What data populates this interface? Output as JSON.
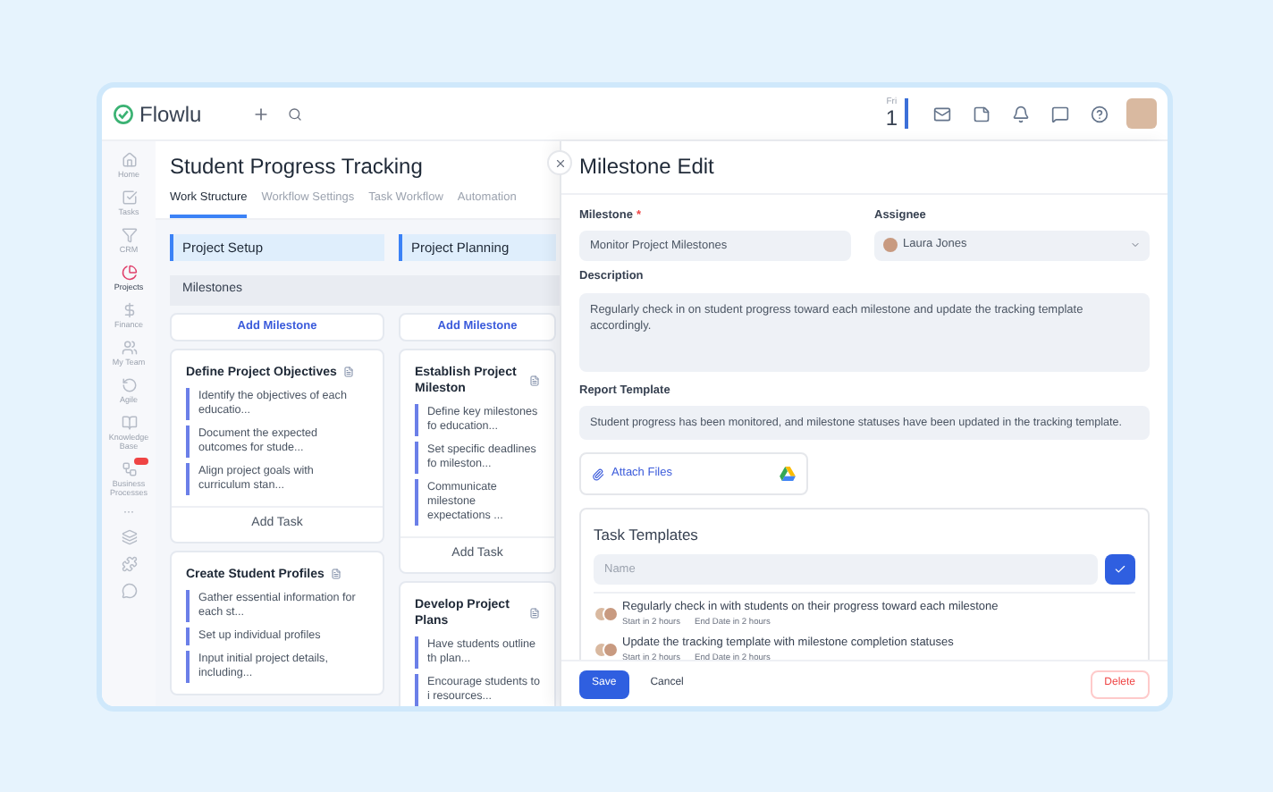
{
  "app": {
    "logo": "Flowlu"
  },
  "topbar": {
    "day": "Fri",
    "date": "1"
  },
  "sidebar": {
    "items": [
      {
        "label": "Home",
        "selected": false,
        "badge": false
      },
      {
        "label": "Tasks",
        "selected": false,
        "badge": false
      },
      {
        "label": "CRM",
        "selected": false,
        "badge": false
      },
      {
        "label": "Projects",
        "selected": true,
        "badge": false
      },
      {
        "label": "Finance",
        "selected": false,
        "badge": false
      },
      {
        "label": "My Team",
        "selected": false,
        "badge": false
      },
      {
        "label": "Agile",
        "selected": false,
        "badge": false
      },
      {
        "label": "Knowledge Base",
        "selected": false,
        "badge": false
      },
      {
        "label": "Business Processes",
        "selected": false,
        "badge": true
      }
    ],
    "more": "···"
  },
  "project": {
    "title": "Student Progress Tracking",
    "tabs": [
      {
        "label": "Work Structure",
        "selected": true
      },
      {
        "label": "Workflow Settings",
        "selected": false
      },
      {
        "label": "Task Workflow",
        "selected": false
      },
      {
        "label": "Automation",
        "selected": false
      }
    ],
    "milestones_label": "Milestones",
    "stages": [
      {
        "name": "Project Setup",
        "add_milestone": "Add Milestone",
        "milestones": [
          {
            "title": "Define Project Objectives",
            "tasks": [
              "Identify the objectives of each educatio...",
              "Document the expected outcomes for stude...",
              "Align project goals with curriculum stan..."
            ],
            "add_task": "Add Task"
          },
          {
            "title": "Create Student Profiles",
            "tasks": [
              "Gather essential information for each st...",
              "Set up individual profiles",
              "Input initial project details, including..."
            ]
          }
        ]
      },
      {
        "name": "Project Planning",
        "add_milestone": "Add Milestone",
        "milestones": [
          {
            "title": "Establish Project Mileston",
            "tasks": [
              "Define key milestones fo education...",
              "Set specific deadlines fo mileston...",
              "Communicate milestone expectations ..."
            ],
            "add_task": "Add Task"
          },
          {
            "title": "Develop Project Plans",
            "tasks": [
              "Have students outline th plan...",
              "Encourage students to i resources..."
            ]
          }
        ]
      }
    ]
  },
  "panel": {
    "title": "Milestone Edit",
    "milestone": {
      "label": "Milestone",
      "required": true,
      "required_mark": "*",
      "value": "Monitor Project Milestones"
    },
    "assignee": {
      "label": "Assignee",
      "value": "Laura Jones"
    },
    "description": {
      "label": "Description",
      "value": "Regularly check in on student progress toward each milestone and update the tracking template accordingly."
    },
    "report_template": {
      "label": "Report Template",
      "value": "Student progress has been monitored, and milestone statuses have been updated in the tracking template."
    },
    "attach": "Attach Files",
    "task_templates": {
      "title": "Task Templates",
      "placeholder": "Name",
      "items": [
        {
          "title": "Regularly check in with students on their progress toward each milestone",
          "start": "Start in 2 hours",
          "end": "End Date in 2 hours"
        },
        {
          "title": "Update the tracking template with milestone completion statuses",
          "start": "Start in 2 hours",
          "end": "End Date in 2 hours"
        }
      ]
    },
    "buttons": {
      "save": "Save",
      "cancel": "Cancel",
      "delete": "Delete"
    }
  }
}
